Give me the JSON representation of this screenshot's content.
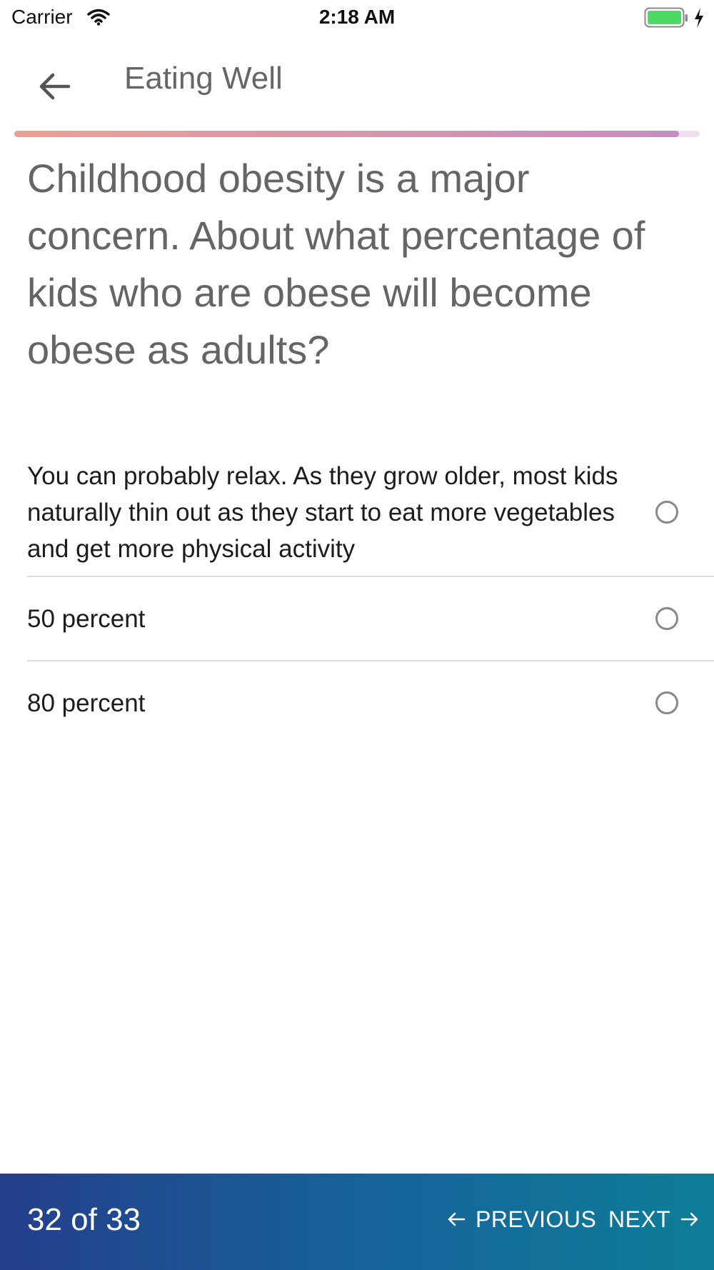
{
  "status_bar": {
    "carrier": "Carrier",
    "time": "2:18 AM"
  },
  "nav": {
    "title": "Eating Well"
  },
  "progress": {
    "fraction": 0.97,
    "color_start": "#eba093",
    "color_end": "#c38ec2"
  },
  "question": {
    "text": "Childhood obesity is a major concern. About what percentage of kids who are obese will become obese as adults?"
  },
  "options": [
    {
      "label": "You can probably relax. As they grow older, most kids naturally thin out as they start to eat more vegetables and get more physical activity",
      "selected": false
    },
    {
      "label": "50 percent",
      "selected": false
    },
    {
      "label": "80 percent",
      "selected": false
    }
  ],
  "footer": {
    "counter": "32 of 33",
    "previous_label": "PREVIOUS",
    "next_label": "NEXT",
    "gradient": [
      "#243f8a",
      "#16629a",
      "#0e7e98"
    ]
  },
  "icons": {
    "back": "arrow-left-icon",
    "wifi": "wifi-icon",
    "battery": "battery-icon",
    "bolt": "charging-bolt-icon"
  }
}
